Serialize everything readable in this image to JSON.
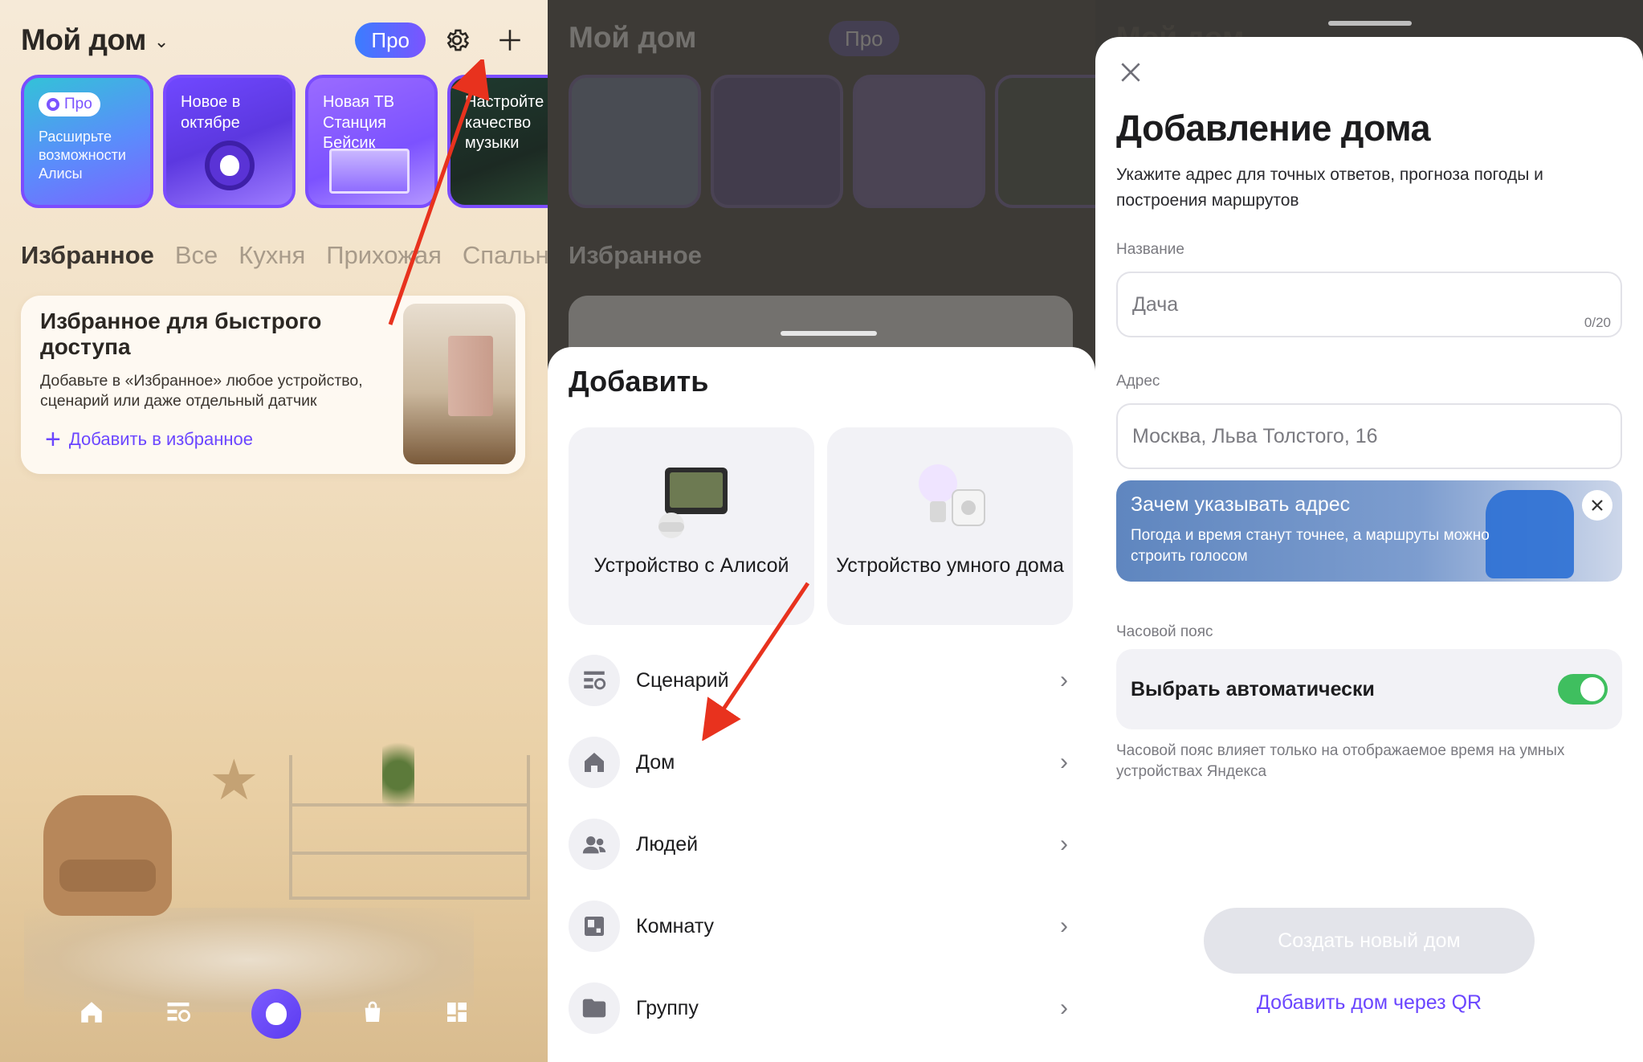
{
  "home": {
    "title": "Мой дом",
    "pro_label": "Про",
    "stories": [
      {
        "chip": "Про",
        "text": "Расширьте возможности Алисы"
      },
      {
        "text": "Новое в октябре"
      },
      {
        "text": "Новая ТВ Станция Бейсик"
      },
      {
        "text": "Настройте качество музыки"
      }
    ],
    "tabs": [
      "Избранное",
      "Все",
      "Кухня",
      "Прихожая",
      "Спальня"
    ],
    "fav_card": {
      "title": "Избранное для быстрого доступа",
      "description": "Добавьте в «Избранное» любое устройство, сценарий или даже отдельный датчик",
      "add_link": "Добавить в избранное"
    }
  },
  "add_sheet": {
    "title": "Добавить",
    "tiles": [
      {
        "label": "Устройство с Алисой",
        "icon": "alice-device-icon"
      },
      {
        "label": "Устройство умного дома",
        "icon": "smart-home-device-icon"
      }
    ],
    "items": [
      {
        "label": "Сценарий",
        "icon": "scenario-icon"
      },
      {
        "label": "Дом",
        "icon": "house-icon"
      },
      {
        "label": "Людей",
        "icon": "people-icon"
      },
      {
        "label": "Комнату",
        "icon": "room-icon"
      },
      {
        "label": "Группу",
        "icon": "folder-icon"
      }
    ]
  },
  "add_home": {
    "title": "Добавление дома",
    "subtitle": "Укажите адрес для точных ответов, прогноза погоды и построения маршрутов",
    "name_label": "Название",
    "name_placeholder": "Дача",
    "name_counter": "0/20",
    "address_label": "Адрес",
    "address_placeholder": "Москва, Льва Толстого, 16",
    "banner_title": "Зачем указывать адрес",
    "banner_text": "Погода и время станут точнее, а маршруты можно строить голосом",
    "tz_label": "Часовой пояс",
    "tz_auto": "Выбрать автоматически",
    "tz_auto_enabled": true,
    "tz_note": "Часовой пояс влияет только на отображаемое время на умных устройствах Яндекса",
    "create_button": "Создать новый дом",
    "qr_link": "Добавить дом через QR"
  },
  "colors": {
    "accent": "#6b46ff",
    "arrow": "#e8321e",
    "toggle_on": "#3fbf5f"
  }
}
